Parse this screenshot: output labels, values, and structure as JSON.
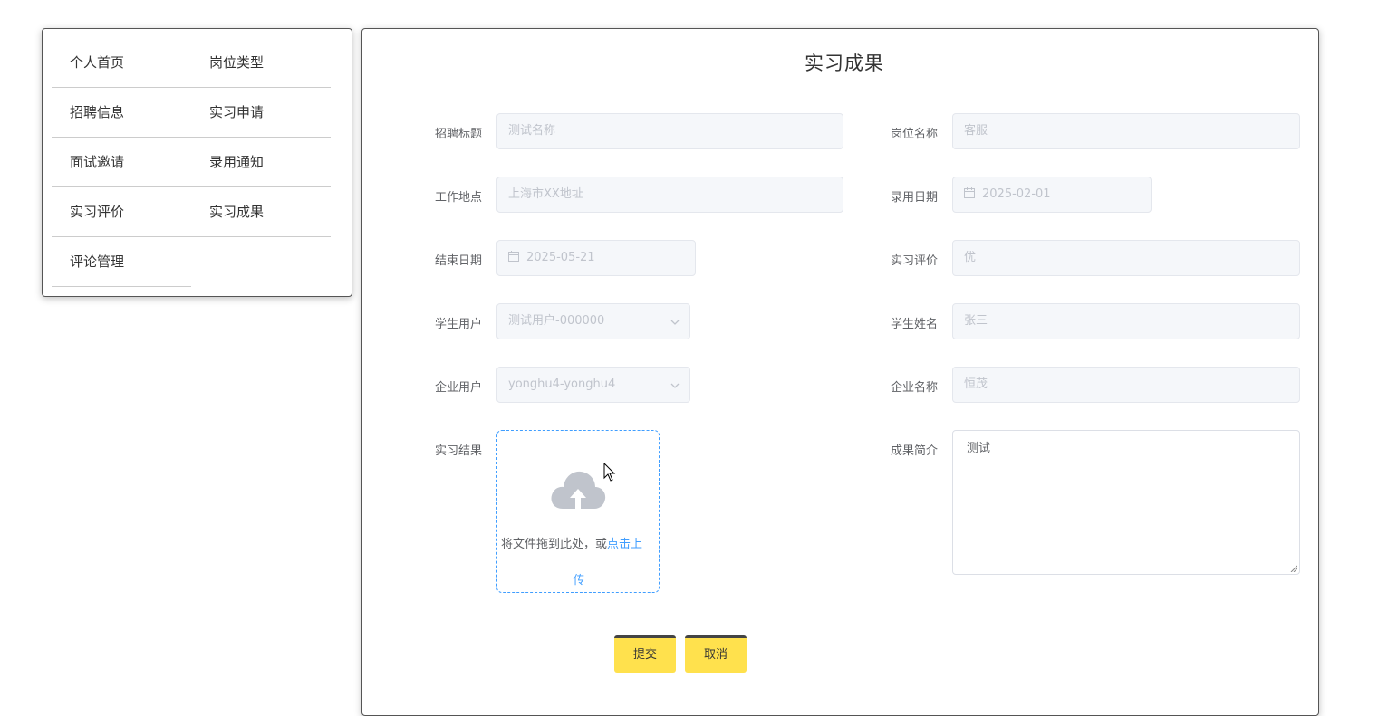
{
  "menu": {
    "items": [
      {
        "label": "个人首页"
      },
      {
        "label": "岗位类型"
      },
      {
        "label": "招聘信息"
      },
      {
        "label": "实习申请"
      },
      {
        "label": "面试邀请"
      },
      {
        "label": "录用通知"
      },
      {
        "label": "实习评价"
      },
      {
        "label": "实习成果"
      },
      {
        "label": "评论管理"
      }
    ]
  },
  "form": {
    "title": "实习成果",
    "fields": {
      "recruit_title": {
        "label": "招聘标题",
        "value": "测试名称"
      },
      "position_name": {
        "label": "岗位名称",
        "value": "客服"
      },
      "work_location": {
        "label": "工作地点",
        "value": "上海市XX地址"
      },
      "hire_date": {
        "label": "录用日期",
        "value": "2025-02-01"
      },
      "end_date": {
        "label": "结束日期",
        "value": "2025-05-21"
      },
      "evaluation": {
        "label": "实习评价",
        "value": "优"
      },
      "student_user": {
        "label": "学生用户",
        "value": "测试用户-000000"
      },
      "student_name": {
        "label": "学生姓名",
        "value": "张三"
      },
      "company_user": {
        "label": "企业用户",
        "value": "yonghu4-yonghu4"
      },
      "company_name": {
        "label": "企业名称",
        "value": "恒茂"
      },
      "result_file": {
        "label": "实习结果"
      },
      "result_intro": {
        "label": "成果简介",
        "value": "测试"
      }
    },
    "upload": {
      "text": "将文件拖到此处，或",
      "link": "点击上",
      "link_cont": "传"
    },
    "buttons": {
      "submit": "提交",
      "cancel": "取消"
    }
  },
  "colors": {
    "button_bg": "#ffe14d",
    "link": "#409eff",
    "disabled_bg": "#f5f7fa"
  }
}
